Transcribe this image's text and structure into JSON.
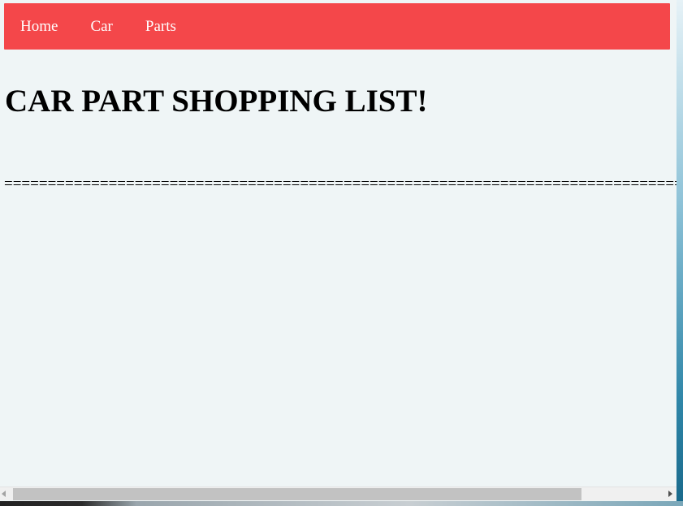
{
  "navbar": {
    "items": [
      {
        "label": "Home"
      },
      {
        "label": "Car"
      },
      {
        "label": "Parts"
      }
    ],
    "background_color": "#f4474a"
  },
  "main": {
    "title": "CAR PART SHOPPING LIST!",
    "separator": "================================================================================================================"
  },
  "scrollbar": {
    "horizontal_position": 0
  },
  "colors": {
    "page_background": "#eff5f6",
    "text": "#000000",
    "nav_text": "#ffffff"
  }
}
